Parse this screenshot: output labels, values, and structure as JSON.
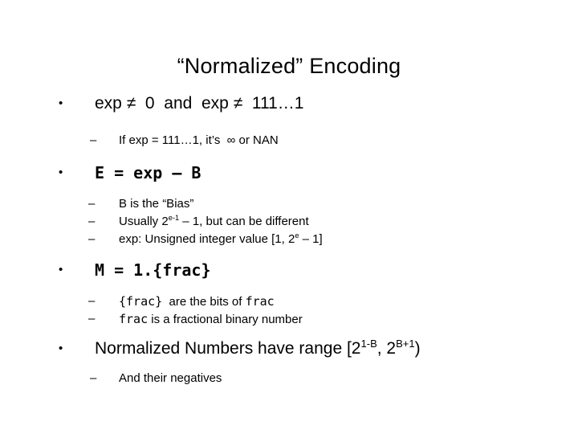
{
  "slide": {
    "title": "“Normalized” Encoding",
    "background_color": "#ffffff",
    "text_color": "#000000",
    "bullet_glyph": "•",
    "dash_glyph": "–",
    "bullets": [
      {
        "level": 1,
        "text": "exp ≠ 0 and exp ≠ 111…1",
        "parts": {
          "exp1": "exp",
          "neq1": "≠",
          "zero": "0",
          "and": "and",
          "exp2": "exp",
          "neq2": "≠",
          "ones": "111…1"
        }
      },
      {
        "level": 2,
        "text": "If exp = 111…1, it’s ∞ or NAN",
        "parts": {
          "lead": "If exp = 111…1, it’s",
          "infinity": "∞",
          "tail": "or NAN"
        }
      },
      {
        "level": 1,
        "code": true,
        "text": "E = exp – B"
      },
      {
        "level": 2,
        "text": "B is the “Bias”"
      },
      {
        "level": 2,
        "text": "Usually 2e-1 – 1, but can be different",
        "parts": {
          "lead": "Usually 2",
          "sup": "e-1",
          "tail": " – 1, but can be different"
        }
      },
      {
        "level": 2,
        "text": "exp: Unsigned integer value [1, 2e – 1]",
        "parts": {
          "lead": "exp: Unsigned integer value [1, 2",
          "sup": "e",
          "tail": " – 1]"
        }
      },
      {
        "level": 1,
        "code": true,
        "text": "M = 1.{frac}"
      },
      {
        "level": 2,
        "text": "{frac} are the bits of frac",
        "parts": {
          "code1": "{frac}",
          "middle": "are the bits of",
          "code2": "frac"
        }
      },
      {
        "level": 2,
        "text": "frac is a fractional binary number",
        "parts": {
          "code1": "frac",
          "tail": "is a fractional binary number"
        }
      },
      {
        "level": 1,
        "text": "Normalized Numbers have range [21-B, 2B+1)",
        "parts": {
          "lead": "Normalized Numbers have range [2",
          "sup1": "1-B",
          "middle": ", 2",
          "sup2": "B+1",
          "tail": ")"
        }
      },
      {
        "level": 2,
        "text": "And their negatives"
      }
    ]
  }
}
